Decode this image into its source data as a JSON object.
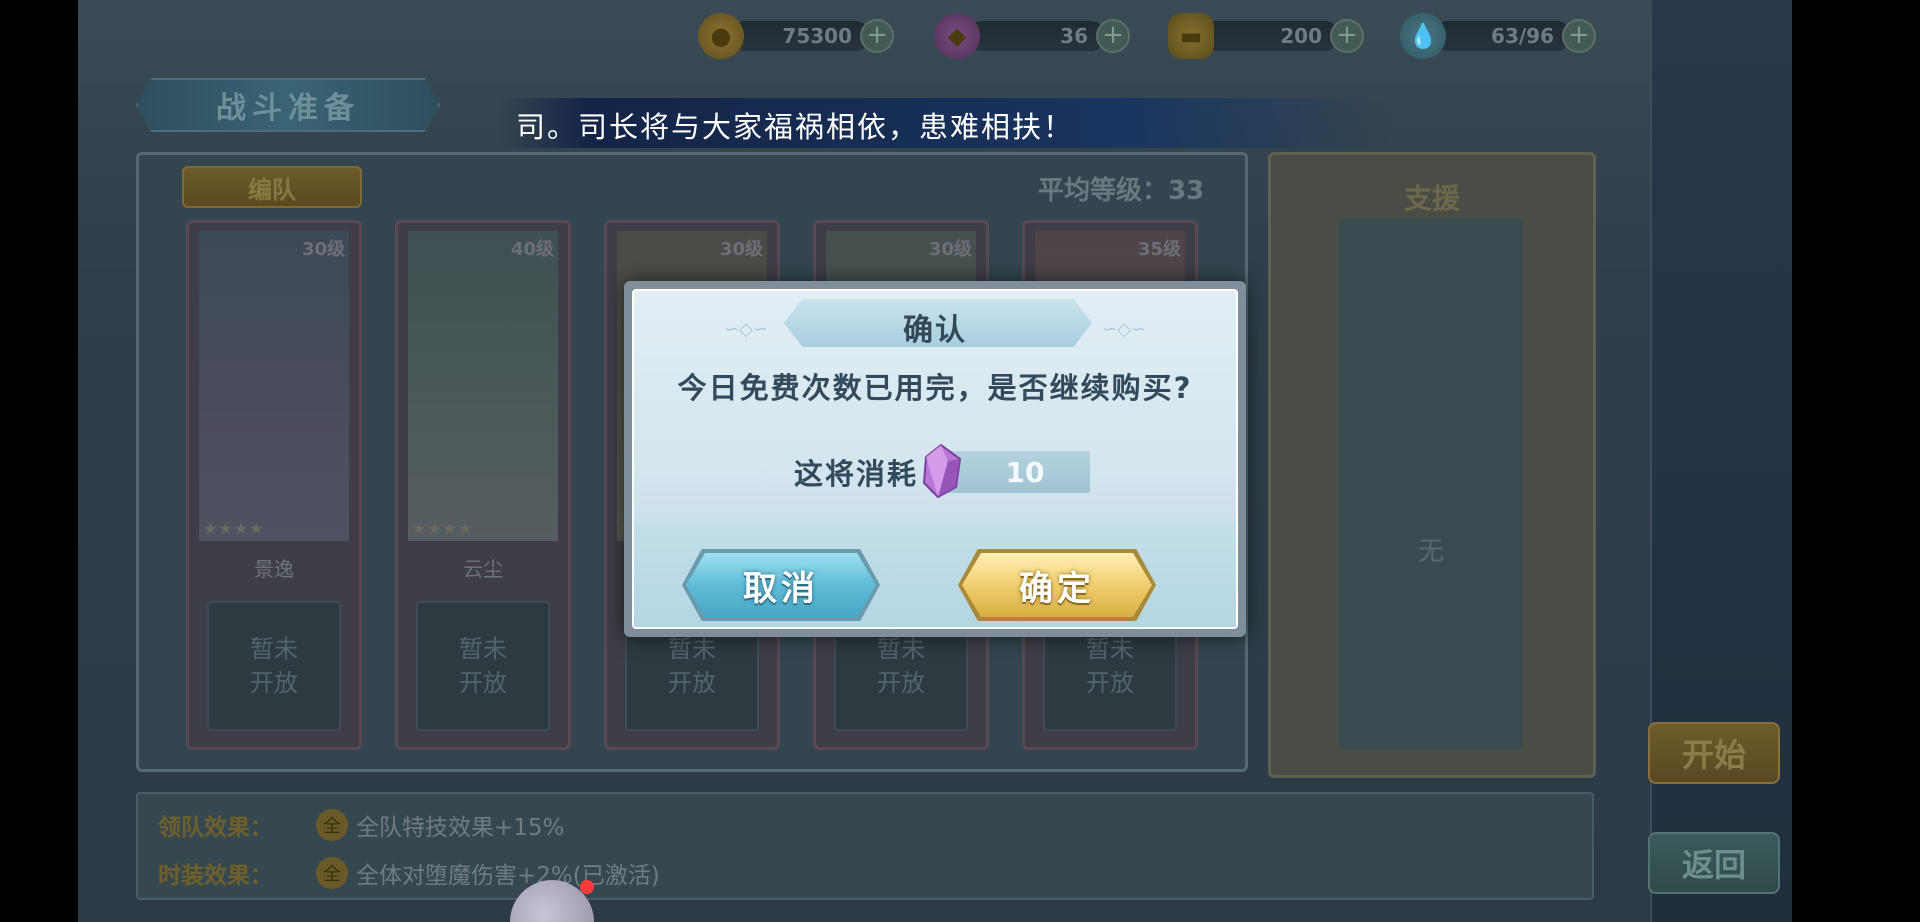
{
  "resources": [
    {
      "icon": "coin-icon",
      "value": "75300"
    },
    {
      "icon": "crystal-icon",
      "value": "36"
    },
    {
      "icon": "gold-ingot-icon",
      "value": "200"
    },
    {
      "icon": "stamina-drop-icon",
      "value": "63/96"
    }
  ],
  "header": {
    "title": "战斗准备",
    "marquee": "司。司长将与大家福祸相依，患难相扶！"
  },
  "team": {
    "formation_label": "编队",
    "avg_level_label": "平均等级：",
    "avg_level_value": "33",
    "characters": [
      {
        "level": "30级",
        "stars": "★★★★",
        "name": "景逸",
        "slot": "暂未\n开放"
      },
      {
        "level": "40级",
        "stars": "★★★★",
        "name": "云尘",
        "slot": "暂未\n开放"
      },
      {
        "level": "30级",
        "stars": "★★★★",
        "name": "",
        "slot": "暂未\n开放"
      },
      {
        "level": "30级",
        "stars": "",
        "name": "",
        "slot": "暂未\n开放"
      },
      {
        "level": "35级",
        "stars": "",
        "name": "",
        "slot": "暂未\n开放"
      }
    ]
  },
  "support": {
    "title": "支援",
    "empty_text": "无"
  },
  "actions": {
    "start_label": "开始",
    "back_label": "返回"
  },
  "effects": {
    "leader_label": "领队效果：",
    "leader_badge": "全",
    "leader_text": "全队特技效果+15%",
    "outfit_label": "时装效果：",
    "outfit_badge": "全",
    "outfit_text": "全体对堕魔伤害+2%(已激活)"
  },
  "dialog": {
    "title": "确认",
    "message": "今日免费次数已用完，是否继续购买?",
    "cost_label": "这将消耗",
    "cost_icon": "purple-crystal-icon",
    "cost_value": "10",
    "cancel_label": "取消",
    "confirm_label": "确定"
  },
  "colors": {
    "cancel_button": "#5fbcd8",
    "confirm_button": "#f0cf6e",
    "dialog_bg": "#d3e5ee",
    "dialog_text": "#334a5c"
  }
}
